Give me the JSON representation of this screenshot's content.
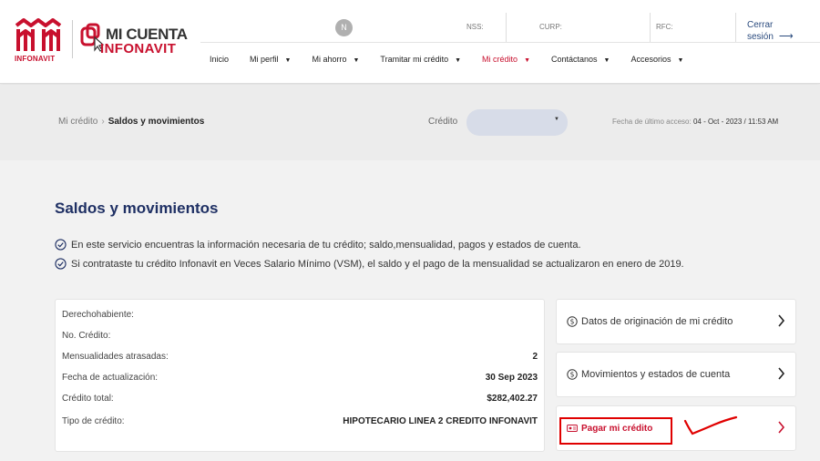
{
  "brand": {
    "infonavit": "INFONAVIT",
    "micuenta_line1": "MI CUENTA",
    "micuenta_line2": "INFONAVIT",
    "color_red": "#c8102e",
    "color_navy": "#1f3064"
  },
  "header": {
    "avatar_initial": "N",
    "nss_label": "NSS:",
    "curp_label": "CURP:",
    "rfc_label": "RFC:",
    "logout_label": "Cerrar sesión",
    "logout_icon": "arrow-right-icon"
  },
  "menu": {
    "items": [
      {
        "label": "Inicio",
        "dropdown": false,
        "active": false
      },
      {
        "label": "Mi perfil",
        "dropdown": true,
        "active": false
      },
      {
        "label": "Mi ahorro",
        "dropdown": true,
        "active": false
      },
      {
        "label": "Tramitar mi crédito",
        "dropdown": true,
        "active": false
      },
      {
        "label": "Mi crédito",
        "dropdown": true,
        "active": true
      },
      {
        "label": "Contáctanos",
        "dropdown": true,
        "active": false
      },
      {
        "label": "Accesorios",
        "dropdown": true,
        "active": false
      }
    ]
  },
  "breadcrumb": {
    "parent": "Mi crédito",
    "separator": "›",
    "current": "Saldos y movimientos"
  },
  "credit_selector": {
    "label": "Crédito",
    "value": "",
    "caret": "▼"
  },
  "last_access": {
    "label": "Fecha de último acceso:",
    "value": "04 - Oct - 2023 / 11:53 AM"
  },
  "main": {
    "title": "Saldos y movimientos",
    "info_lines": [
      "En este servicio encuentras la información necesaria de tu crédito; saldo,mensualidad, pagos y estados de cuenta.",
      "Si contrataste tu crédito Infonavit en Veces Salario Mínimo (VSM), el saldo y el pago de la mensualidad se actualizaron en enero de 2019."
    ]
  },
  "details": {
    "rows": [
      {
        "label": "Derechohabiente:",
        "value": ""
      },
      {
        "label": "No. Crédito:",
        "value": ""
      },
      {
        "label": "Mensualidades atrasadas:",
        "value": "2"
      },
      {
        "label": "Fecha de actualización:",
        "value": "30 Sep 2023"
      },
      {
        "label": "Crédito total:",
        "value": "$282,402.27"
      },
      {
        "label": "Tipo de crédito:",
        "value": "HIPOTECARIO LINEA 2 CREDITO INFONAVIT"
      }
    ]
  },
  "actions": [
    {
      "label": "Datos de originación de mi crédito",
      "icon": "dollar-circle-icon"
    },
    {
      "label": "Movimientos y estados de cuenta",
      "icon": "dollar-circle-icon"
    },
    {
      "label": "Pagar mi crédito",
      "icon": "payment-card-icon"
    }
  ]
}
